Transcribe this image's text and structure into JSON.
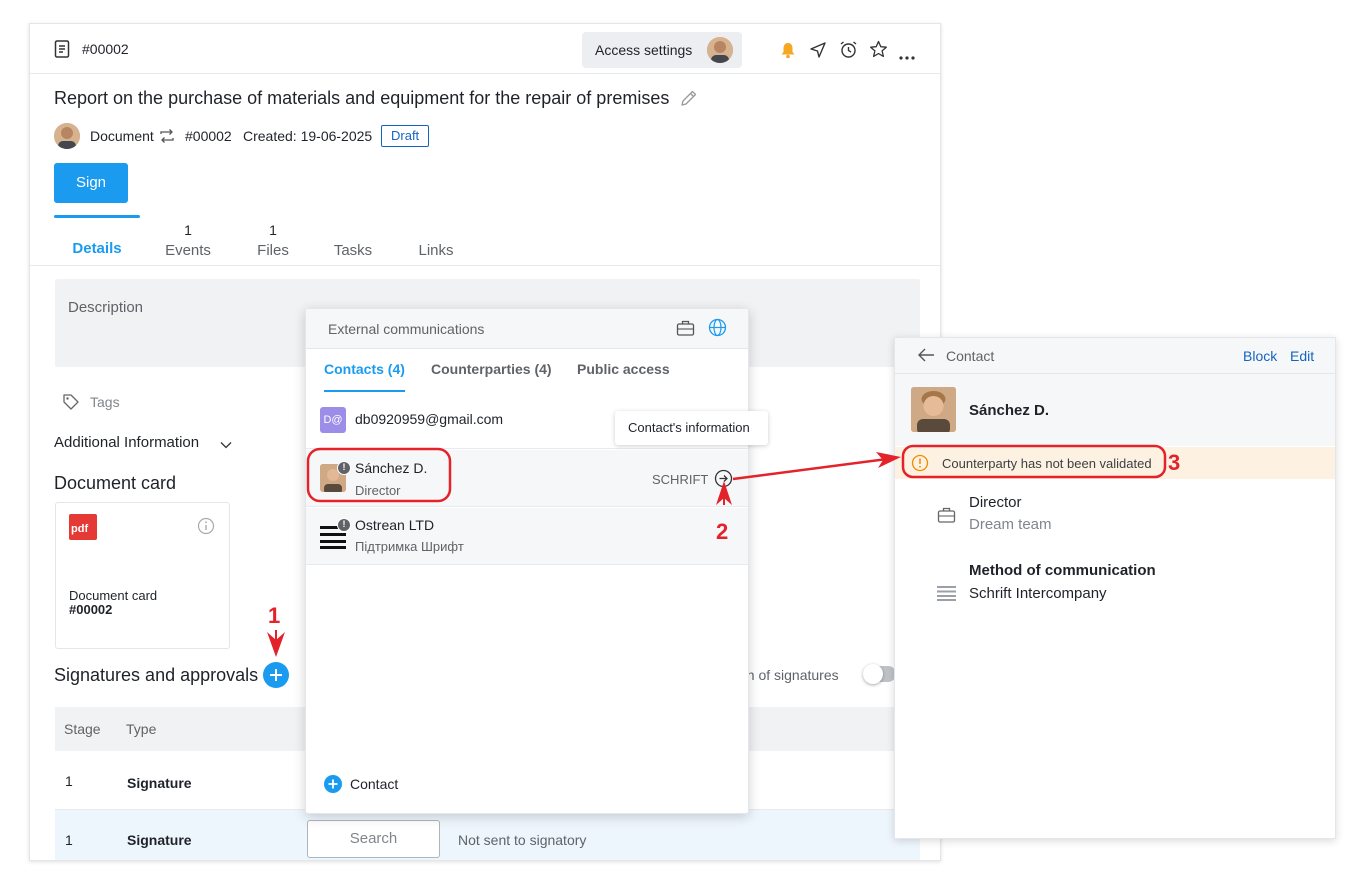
{
  "document": {
    "id": "#00002",
    "access_settings": "Access settings",
    "title": "Report on the purchase of materials and equipment for the repair of premises",
    "meta_type": "Document",
    "meta_id": "#00002",
    "created": "Created: 19-06-2025",
    "status": "Draft",
    "sign_button": "Sign",
    "tabs": [
      {
        "label": "Details",
        "count": ""
      },
      {
        "label": "Events",
        "count": "1"
      },
      {
        "label": "Files",
        "count": "1"
      },
      {
        "label": "Tasks",
        "count": ""
      },
      {
        "label": "Links",
        "count": ""
      }
    ],
    "description_label": "Description",
    "tags_label": "Tags",
    "additional_info": "Additional Information",
    "document_card_heading": "Document card",
    "card": {
      "pdf": "pdf",
      "name": "Document card",
      "id": "#00002"
    },
    "signatures_heading": "Signatures and approvals",
    "signatures_toggle_label": "on of signatures",
    "table": {
      "headers": [
        "Stage",
        "Type"
      ],
      "rows": [
        {
          "stage": "1",
          "type": "Signature"
        },
        {
          "stage": "1",
          "type": "Signature",
          "search": "Search",
          "status": "Not sent to signatory"
        }
      ]
    }
  },
  "popup": {
    "title": "External communications",
    "tabs": [
      "Contacts (4)",
      "Counterparties (4)",
      "Public access"
    ],
    "tooltip": "Contact's information",
    "items": [
      {
        "avatar_text": "D@",
        "name": "db0920959@gmail.com"
      },
      {
        "name": "Sánchez D.",
        "sub": "Director",
        "right": "SCHRIFT"
      },
      {
        "name": "Ostrean LTD",
        "sub": "Підтримка Шрифт"
      }
    ],
    "add_contact": "Contact"
  },
  "contact": {
    "back_label": "Contact",
    "block": "Block",
    "edit": "Edit",
    "name": "Sánchez D.",
    "warning": "Counterparty has not been validated",
    "position": "Director",
    "team": "Dream team",
    "method_label": "Method of communication",
    "method_value": "Schrift Intercompany"
  },
  "annotations": [
    "1",
    "2",
    "3"
  ],
  "colors": {
    "accent": "#1a9bf0",
    "red": "#e3222a",
    "warning_bg": "#fdf1e2",
    "bell": "#f5a623"
  }
}
